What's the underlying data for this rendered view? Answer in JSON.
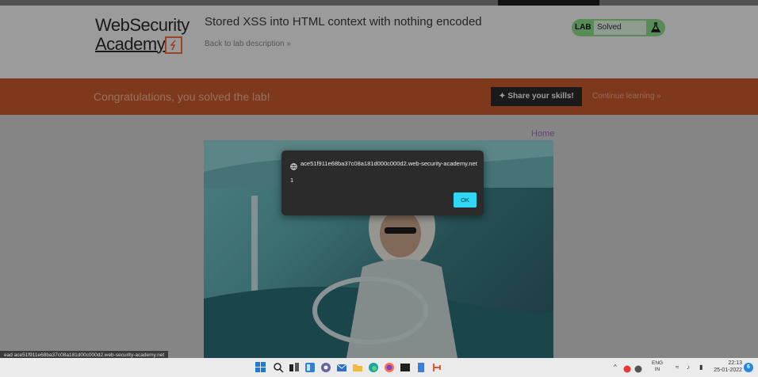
{
  "header": {
    "logo_line1": "WebSecurity",
    "logo_line2": "Academy",
    "lab_title": "Stored XSS into HTML context with nothing encoded",
    "back_link": "Back to lab description »",
    "status_tag": "LAB",
    "status_value": "Solved"
  },
  "banner": {
    "message": "Congratulations, you solved the lab!",
    "share_label": "Share your skills!",
    "continue_label": "Continue learning »"
  },
  "content": {
    "home_link": "Home"
  },
  "dialog": {
    "origin": "ace51f911e68ba37c08a181d000c000d2.web-security-academy.net",
    "message": "1",
    "ok_label": "OK"
  },
  "status_bar": {
    "url": "ead ace51f911e68ba37c08a181d00c000d2.web-security-academy.net"
  },
  "taskbar": {
    "icons": [
      "windows-start-icon",
      "search-icon",
      "task-view-icon",
      "widgets-icon",
      "chat-icon",
      "mail-icon",
      "file-explorer-icon",
      "edge-icon",
      "firefox-icon",
      "terminal-icon",
      "notes-icon",
      "app-icon"
    ],
    "tray_lang": "ENG",
    "tray_region": "IN",
    "time": "22:13",
    "date": "25-01-2022",
    "notification_count": "6"
  },
  "colors": {
    "banner": "#c6582b",
    "status_green": "#8bd98c",
    "ok_button": "#2ed7f6",
    "dialog_bg": "#2b2b2b"
  }
}
